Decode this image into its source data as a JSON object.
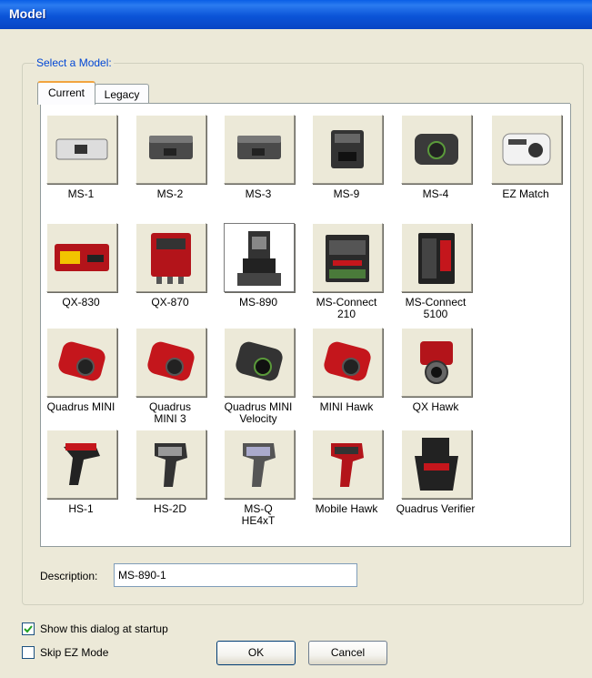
{
  "window": {
    "title": "Model"
  },
  "group": {
    "legend": "Select a Model:"
  },
  "tabs": [
    {
      "label": "Current"
    },
    {
      "label": "Legacy"
    }
  ],
  "models": [
    {
      "lines": [
        "MS-1"
      ],
      "icon": "ms1-camera-icon"
    },
    {
      "lines": [
        "MS-2"
      ],
      "icon": "ms2-camera-icon"
    },
    {
      "lines": [
        "MS-3"
      ],
      "icon": "ms3-camera-icon"
    },
    {
      "lines": [
        "MS-9"
      ],
      "icon": "ms9-camera-icon"
    },
    {
      "lines": [
        "MS-4"
      ],
      "icon": "ms4-camera-icon"
    },
    {
      "lines": [
        "EZ Match"
      ],
      "icon": "ez-match-camera-icon"
    },
    {
      "lines": [
        "QX-830"
      ],
      "icon": "qx830-scanner-icon"
    },
    {
      "lines": [
        "QX-870"
      ],
      "icon": "qx870-scanner-icon"
    },
    {
      "lines": [
        "MS-890"
      ],
      "icon": "ms890-scanner-icon",
      "selected": true
    },
    {
      "lines": [
        "MS-Connect",
        "210"
      ],
      "icon": "ms-connect-210-icon"
    },
    {
      "lines": [
        "MS-Connect",
        "5100"
      ],
      "icon": "ms-connect-5100-icon"
    },
    {
      "lines": [
        "Quadrus MINI"
      ],
      "icon": "quadrus-mini-icon"
    },
    {
      "lines": [
        "Quadrus",
        "MINI 3"
      ],
      "icon": "quadrus-mini-3-icon"
    },
    {
      "lines": [
        "Quadrus MINI",
        "Velocity"
      ],
      "icon": "quadrus-mini-velocity-icon"
    },
    {
      "lines": [
        "MINI Hawk"
      ],
      "icon": "mini-hawk-icon"
    },
    {
      "lines": [
        "QX Hawk"
      ],
      "icon": "qx-hawk-icon"
    },
    {
      "lines": [
        "HS-1"
      ],
      "icon": "hs1-handheld-icon"
    },
    {
      "lines": [
        "HS-2D"
      ],
      "icon": "hs2d-handheld-icon"
    },
    {
      "lines": [
        "MS-Q",
        "HE4xT"
      ],
      "icon": "msq-he4xt-handheld-icon"
    },
    {
      "lines": [
        "Mobile Hawk"
      ],
      "icon": "mobile-hawk-handheld-icon"
    },
    {
      "lines": [
        "Quadrus Verifier"
      ],
      "icon": "quadrus-verifier-icon"
    }
  ],
  "description": {
    "label": "Description:",
    "value": "MS-890-1"
  },
  "options": {
    "show_at_startup": {
      "label": "Show this dialog at startup",
      "checked": true
    },
    "skip_ez_mode": {
      "label": "Skip EZ Mode",
      "checked": false
    }
  },
  "buttons": {
    "ok": "OK",
    "cancel": "Cancel"
  },
  "colors": {
    "title_blue": "#0b54d8",
    "legend_blue": "#0046d5",
    "accent_red": "#c4161c",
    "dialog_bg": "#ece9d8"
  }
}
